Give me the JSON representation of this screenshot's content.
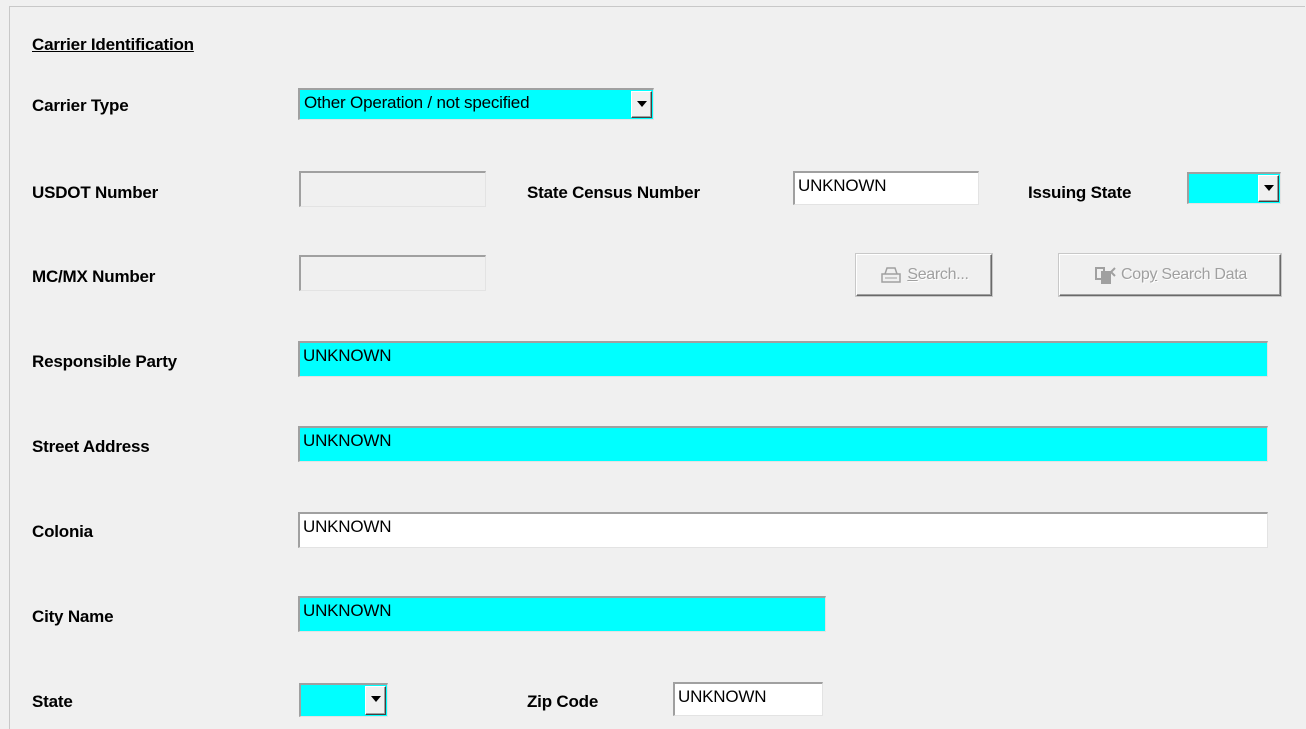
{
  "section": {
    "title": "Carrier Identification"
  },
  "carrier_type": {
    "label": "Carrier Type",
    "value": "Other Operation / not specified"
  },
  "usdot": {
    "label": "USDOT Number",
    "value": ""
  },
  "state_census": {
    "label": "State Census Number",
    "value": "UNKNOWN"
  },
  "issuing_state": {
    "label": "Issuing State",
    "value": ""
  },
  "mcmx": {
    "label": "MC/MX Number",
    "value": ""
  },
  "buttons": {
    "search_pre": "",
    "search_key": "S",
    "search_post": "earch...",
    "search_icon": "printer-search-icon",
    "copy_pre": "Cop",
    "copy_key": "y",
    "copy_post": " Search Data",
    "copy_icon": "copy-data-icon"
  },
  "responsible_party": {
    "label": "Responsible Party",
    "value": "UNKNOWN"
  },
  "street_address": {
    "label": "Street Address",
    "value": "UNKNOWN"
  },
  "colonia": {
    "label": "Colonia",
    "value": "UNKNOWN"
  },
  "city_name": {
    "label": "City Name",
    "value": "UNKNOWN"
  },
  "state": {
    "label": "State",
    "value": ""
  },
  "zip_code": {
    "label": "Zip Code",
    "value": "UNKNOWN"
  },
  "colors": {
    "required_field": "#00ffff",
    "window_bg": "#f0f0f0",
    "disabled_text": "#a0a0a0"
  }
}
